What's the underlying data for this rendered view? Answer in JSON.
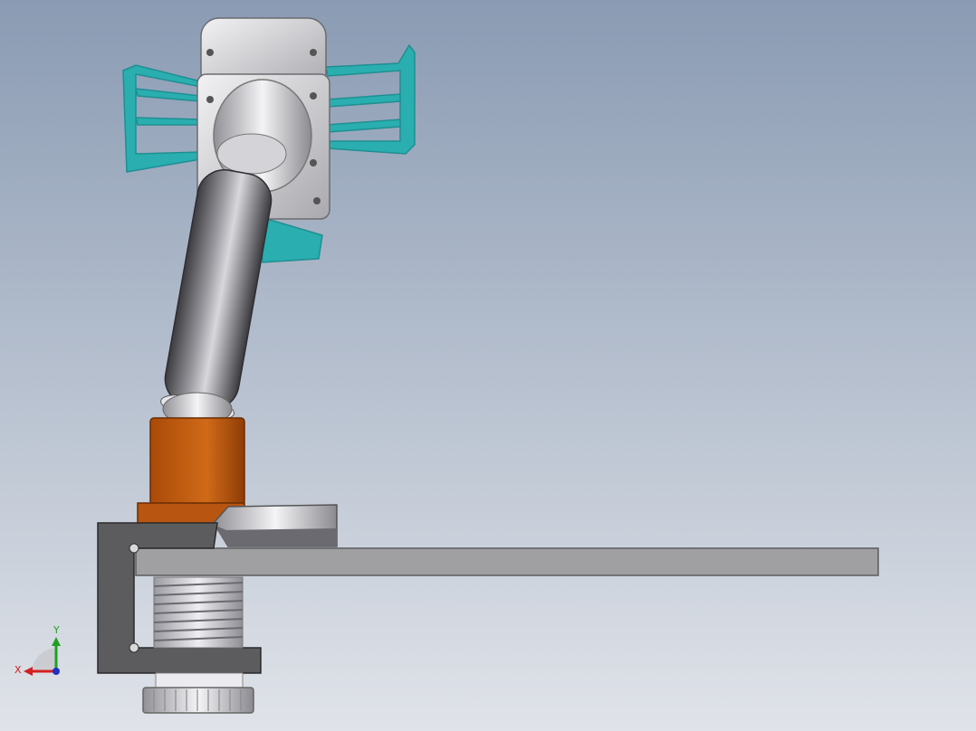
{
  "scene": {
    "background_top": "#8c9cb4",
    "background_bottom": "#dfe2e8",
    "colors": {
      "bracket_cyan": "#27a6a9",
      "clamp_frame": "#5a5a5a",
      "table_edge": "#9c9c9c",
      "orange_collar": "#c5600f",
      "steel_light": "#e6e6ea",
      "steel_dark": "#5e5e62"
    }
  },
  "triad": {
    "x_label": "X",
    "y_label": "Y",
    "x_color": "#d42020",
    "y_color": "#20a020",
    "z_color": "#2030c0"
  }
}
